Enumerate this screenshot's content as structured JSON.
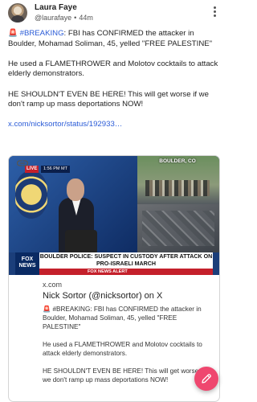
{
  "author": {
    "name": "Laura Faye",
    "handle": "@laurafaye",
    "separator": "•",
    "time": "44m"
  },
  "post": {
    "siren": "🚨",
    "hashtag": "#BREAKING",
    "line1_rest": ": FBI has CONFIRMED the attacker in Boulder, Mohamad Soliman, 45, yelled \"FREE PALESTINE\"",
    "line2": "He used a FLAMETHROWER and Molotov cocktails to attack elderly demonstrators.",
    "line3": "HE SHOULDN'T EVEN BE HERE! This will get worse if we don't ramp up mass deportations NOW!",
    "link": "x.com/nicksortor/status/192933…"
  },
  "card": {
    "thumbnail": {
      "place": "BOULDER, CO",
      "live": "LIVE",
      "live_time": "1:56 PM MT",
      "network": "FOX NEWS",
      "headline": "BOULDER POLICE: SUSPECT IN CUSTODY AFTER ATTACK ON PRO-ISRAELI MARCH",
      "alert": "FOX NEWS ALERT"
    },
    "domain": "x.com",
    "title": "Nick Sortor (@nicksortor) on X",
    "text_line1": "🚨 #BREAKING: FBI has CONFIRMED the attacker in Boulder, Mohamad Soliman, 45, yelled \"FREE PALESTINE\"",
    "text_line2": "He used a FLAMETHROWER and Molotov cocktails to attack elderly demonstrators.",
    "text_line3": "HE SHOULDN'T EVEN BE HERE! This will get worse if we don't ramp up mass deportations NOW!"
  },
  "icons": {
    "more": "more-vertical-icon",
    "link": "link-icon",
    "compose": "pencil-icon"
  },
  "colors": {
    "link": "#2a5bd7",
    "fab": "#ef476f",
    "siren": "#d62d20"
  }
}
